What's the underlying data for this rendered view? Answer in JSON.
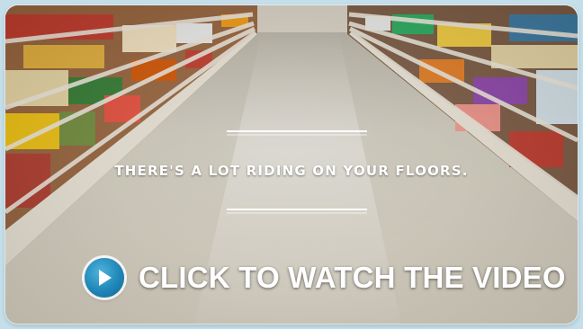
{
  "banner": {
    "tagline": "THERE'S A LOT RIDING ON YOUR FLOORS.",
    "cta_label": "CLICK TO WATCH THE VIDEO",
    "play_icon": "play-icon",
    "background_scene": "grocery-store-aisle"
  },
  "colors": {
    "frame": "#c4dfea",
    "play_button": "#1f86b8",
    "text": "#ffffff"
  }
}
